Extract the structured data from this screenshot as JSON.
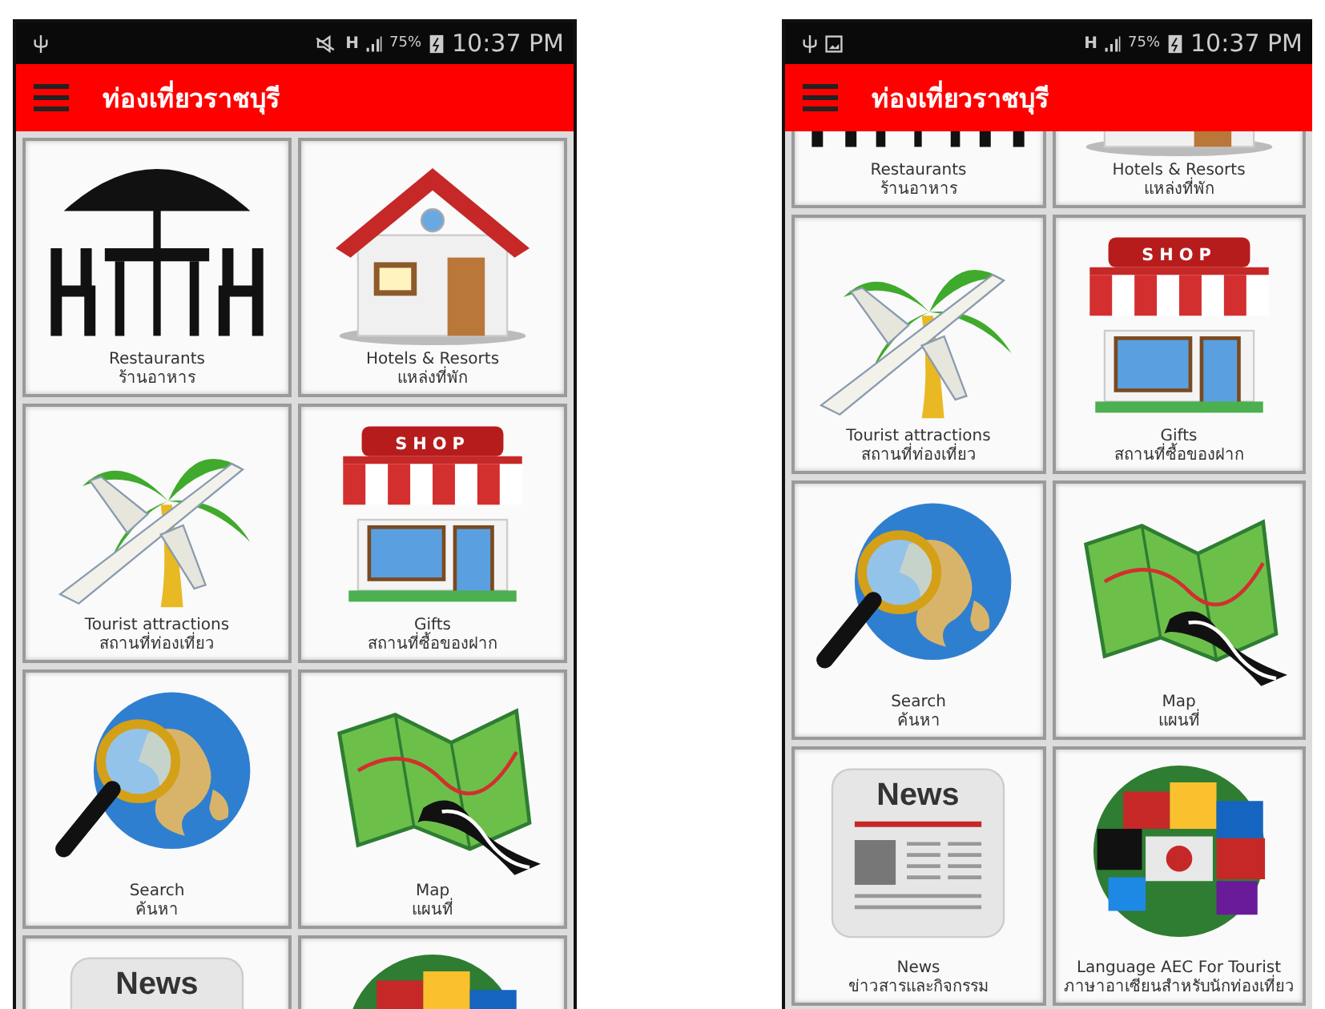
{
  "phones": [
    {
      "status_bar": {
        "notifications": [
          {
            "kind": "usb"
          }
        ],
        "system": [
          {
            "kind": "mute"
          }
        ],
        "network": "H",
        "battery": "75%",
        "time": "10:37 PM"
      },
      "app_bar": {
        "title": "ท่องเที่ยวราชบุรี"
      },
      "tile_rows": [
        {
          "tiles": [
            {
              "kind": "restaurant",
              "label": "Restaurants",
              "label_th": "ร้านอาหาร"
            },
            {
              "kind": "hotel",
              "label": "Hotels & Resorts",
              "label_th": "แหล่งที่พัก"
            }
          ]
        },
        {
          "tiles": [
            {
              "kind": "tourist",
              "label": "Tourist attractions",
              "label_th": "สถานที่ท่องเที่ยว"
            },
            {
              "kind": "gifts",
              "label": "Gifts",
              "label_th": "สถานที่ซื้อของฝาก",
              "picture": {
                "sign": "SHOP"
              }
            }
          ]
        },
        {
          "tiles": [
            {
              "kind": "search",
              "label": "Search",
              "label_th": "ค้นหา"
            },
            {
              "kind": "map",
              "label": "Map",
              "label_th": "แผนที่"
            }
          ]
        },
        {
          "tiles": [
            {
              "kind": "news",
              "picture": {
                "sign": "News"
              }
            },
            {
              "kind": "language"
            }
          ]
        }
      ]
    },
    {
      "status_bar": {
        "notifications": [
          {
            "kind": "usb"
          },
          {
            "kind": "gallery"
          }
        ],
        "network": "H",
        "battery": "75%",
        "time": "10:37 PM"
      },
      "app_bar": {
        "title": "ท่องเที่ยวราชบุรี"
      },
      "tile_rows": [
        {
          "tiles": [
            {
              "kind": "restaurant",
              "label": "Restaurants",
              "label_th": "ร้านอาหาร"
            },
            {
              "kind": "hotel",
              "label": "Hotels & Resorts",
              "label_th": "แหล่งที่พัก"
            }
          ]
        },
        {
          "tiles": [
            {
              "kind": "tourist",
              "label": "Tourist attractions",
              "label_th": "สถานที่ท่องเที่ยว"
            },
            {
              "kind": "gifts",
              "label": "Gifts",
              "label_th": "สถานที่ซื้อของฝาก",
              "picture": {
                "sign": "SHOP"
              }
            }
          ]
        },
        {
          "tiles": [
            {
              "kind": "search",
              "label": "Search",
              "label_th": "ค้นหา"
            },
            {
              "kind": "map",
              "label": "Map",
              "label_th": "แผนที่"
            }
          ]
        },
        {
          "tiles": [
            {
              "kind": "news",
              "label": "News",
              "label_th": "ข่าวสารและกิจกรรม",
              "picture": {
                "sign": "News"
              }
            },
            {
              "kind": "language",
              "label": "Language AEC For Tourist",
              "label_th": "ภาษาอาเซียนสำหรับนักท่องเที่ยว"
            }
          ]
        }
      ]
    }
  ]
}
